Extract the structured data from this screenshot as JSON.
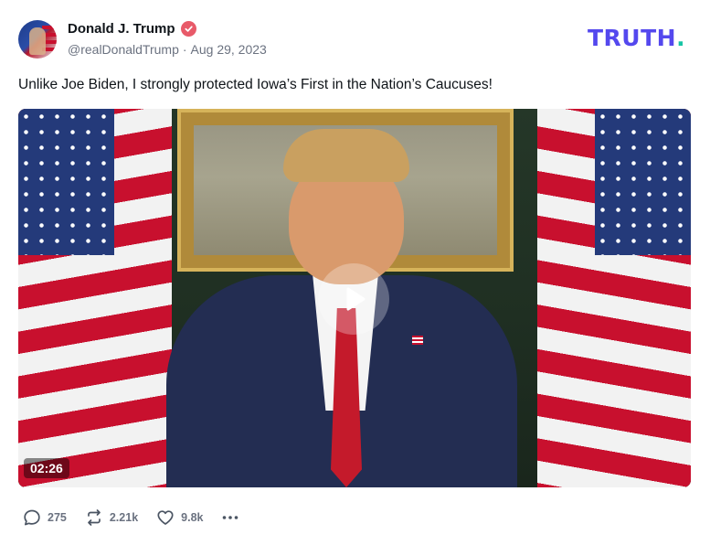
{
  "post": {
    "author": {
      "display_name": "Donald J. Trump",
      "handle": "@realDonaldTrump",
      "verified": true,
      "verified_color": "#e85a69"
    },
    "separator": "·",
    "date": "Aug 29, 2023",
    "text": "Unlike Joe Biden, I strongly protected Iowa’s First in the Nation’s Caucuses!",
    "video": {
      "duration": "02:26",
      "play_icon": "play-icon"
    }
  },
  "brand": {
    "logo_text": "TRUTH",
    "logo_dot": ".",
    "logo_color": "#5448ee",
    "dot_color": "#17c5a5"
  },
  "actions": {
    "replies": "275",
    "retruths": "2.21k",
    "likes": "9.8k",
    "more_icon": "more-icon"
  }
}
